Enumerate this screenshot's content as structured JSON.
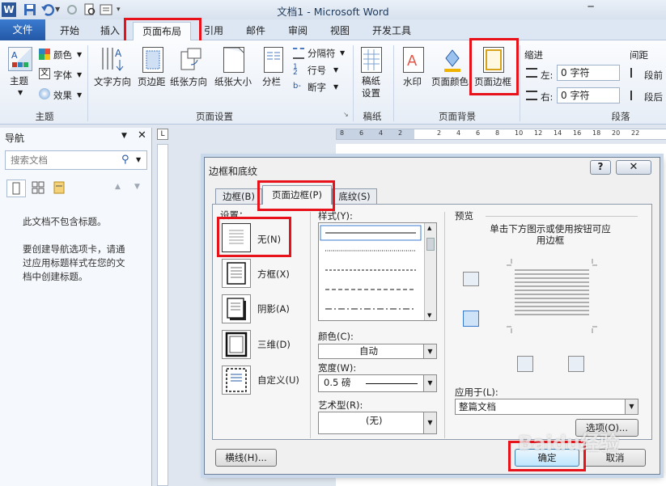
{
  "window": {
    "title": "文档1 - Microsoft Word"
  },
  "tabs": [
    {
      "label": "文件"
    },
    {
      "label": "开始"
    },
    {
      "label": "插入"
    },
    {
      "label": "页面布局"
    },
    {
      "label": "引用"
    },
    {
      "label": "邮件"
    },
    {
      "label": "审阅"
    },
    {
      "label": "视图"
    },
    {
      "label": "开发工具"
    }
  ],
  "ribbon": {
    "theme": {
      "label": "主题",
      "colors": "颜色",
      "fonts": "字体",
      "effects": "效果",
      "group": "主题"
    },
    "page_setup": {
      "text_direction": "文字方向",
      "margins": "页边距",
      "orientation": "纸张方向",
      "size": "纸张大小",
      "columns": "分栏",
      "breaks": "分隔符",
      "line_numbers": "行号",
      "hyphenation": "断字",
      "group": "页面设置"
    },
    "manuscript": {
      "label": "稿纸\n设置",
      "group": "稿纸"
    },
    "background": {
      "watermark": "水印",
      "page_color": "页面颜色",
      "page_borders": "页面边框",
      "group": "页面背景"
    },
    "paragraph": {
      "indent": "缩进",
      "spacing": "间距",
      "left": "左:",
      "right": "右:",
      "left_value": "0 字符",
      "right_value": "0 字符",
      "before": "段前",
      "after": "段后",
      "group": "段落"
    }
  },
  "nav": {
    "title": "导航",
    "search_placeholder": "搜索文档",
    "message1": "此文档不包含标题。",
    "message2": "要创建导航选项卡，请通过应用标题样式在您的文档中创建标题。"
  },
  "ruler": {
    "ticks": [
      "8",
      "6",
      "4",
      "2",
      "",
      "2",
      "4",
      "6",
      "8",
      "10",
      "12",
      "14",
      "16",
      "18",
      "20",
      "22"
    ]
  },
  "dialog": {
    "title": "边框和底纹",
    "help": "?",
    "tabs": [
      "边框(B)",
      "页面边框(P)",
      "底纹(S)"
    ],
    "settings_label": "设置：",
    "settings": [
      "无(N)",
      "方框(X)",
      "阴影(A)",
      "三维(D)",
      "自定义(U)"
    ],
    "style_label": "样式(Y):",
    "color_label": "颜色(C):",
    "color_value": "自动",
    "width_label": "宽度(W):",
    "width_value": "0.5 磅",
    "art_label": "艺术型(R):",
    "art_value": "(无)",
    "preview_label": "预览",
    "preview_hint": "单击下方图示或使用按钮可应用边框",
    "apply_to_label": "应用于(L):",
    "apply_to_value": "整篇文档",
    "options_button": "选项(O)...",
    "horizontal_line_button": "横线(H)...",
    "ok_button": "确定",
    "cancel_button": "取消"
  },
  "watermark": "Baidu经验"
}
